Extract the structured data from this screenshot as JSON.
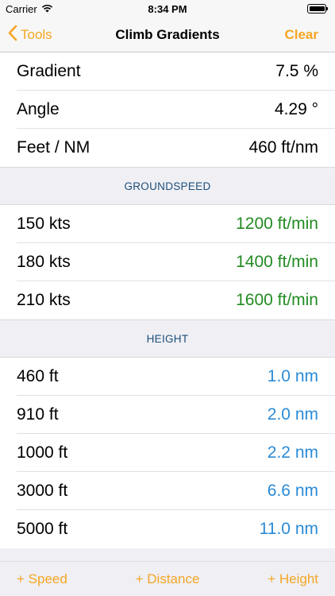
{
  "status_bar": {
    "carrier": "Carrier",
    "time": "8:34 PM",
    "wifi_icon": "wifi-icon",
    "battery_icon": "battery-icon"
  },
  "nav": {
    "back_label": "Tools",
    "title": "Climb Gradients",
    "clear_label": "Clear",
    "accent_color": "#f5a623"
  },
  "summary": [
    {
      "label": "Gradient",
      "value": "7.5 %"
    },
    {
      "label": "Angle",
      "value": "4.29 °"
    },
    {
      "label": "Feet / NM",
      "value": "460 ft/nm"
    }
  ],
  "groundspeed": {
    "header": "GROUNDSPEED",
    "rows": [
      {
        "label": "150 kts",
        "value": "1200 ft/min"
      },
      {
        "label": "180 kts",
        "value": "1400 ft/min"
      },
      {
        "label": "210 kts",
        "value": "1600 ft/min"
      }
    ],
    "value_color": "#228b22"
  },
  "height": {
    "header": "HEIGHT",
    "rows": [
      {
        "label": "460 ft",
        "value": "1.0 nm"
      },
      {
        "label": "910 ft",
        "value": "2.0 nm"
      },
      {
        "label": "1000 ft",
        "value": "2.2 nm"
      },
      {
        "label": "3000 ft",
        "value": "6.6 nm"
      },
      {
        "label": "5000 ft",
        "value": "11.0 nm"
      }
    ],
    "value_color": "#2a8bd6"
  },
  "toolbar": {
    "speed_label": "+ Speed",
    "distance_label": "+ Distance",
    "height_label": "+ Height"
  }
}
